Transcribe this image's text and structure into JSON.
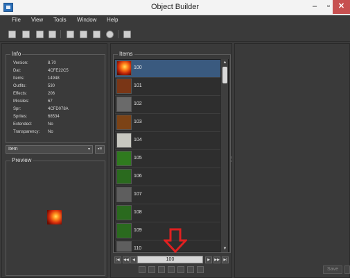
{
  "window": {
    "title": "Object Builder",
    "minimize": "–",
    "maximize": "▫",
    "close": "✕"
  },
  "menu": {
    "items": [
      "File",
      "View",
      "Tools",
      "Window",
      "Help"
    ]
  },
  "toolbar": {
    "icons": [
      "new-file-icon",
      "open-folder-icon",
      "save-icon",
      "save-as-icon",
      "compile-icon",
      "search-icon",
      "animation-editor-icon",
      "play-icon",
      "sprite-sheet-icon"
    ]
  },
  "info": {
    "legend": "Info",
    "rows": [
      {
        "label": "Version:",
        "value": "8.70"
      },
      {
        "label": "Dat:",
        "value": "4CFE22C5"
      },
      {
        "label": "Items:",
        "value": "14948"
      },
      {
        "label": "Outfits:",
        "value": "530"
      },
      {
        "label": "Effects:",
        "value": "206"
      },
      {
        "label": "Missiles:",
        "value": "67"
      },
      {
        "label": "Spr:",
        "value": "4CFD078A"
      },
      {
        "label": "Sprites:",
        "value": "68534"
      },
      {
        "label": "Extended:",
        "value": "No"
      },
      {
        "label": "Transparency:",
        "value": "No"
      }
    ]
  },
  "category": {
    "selected": "Item",
    "arrow": "▾",
    "button": "▪≡"
  },
  "preview": {
    "legend": "Preview"
  },
  "items_panel": {
    "legend": "Items",
    "rows": [
      {
        "label": "100",
        "selected": true,
        "thumb": "#d84a12"
      },
      {
        "label": "101",
        "selected": false,
        "thumb": "#7a3616"
      },
      {
        "label": "102",
        "selected": false,
        "thumb": "#6a6a6a"
      },
      {
        "label": "103",
        "selected": false,
        "thumb": "#7c4316"
      },
      {
        "label": "104",
        "selected": false,
        "thumb": "#c8c8c0"
      },
      {
        "label": "105",
        "selected": false,
        "thumb": "#2f7a1e"
      },
      {
        "label": "106",
        "selected": false,
        "thumb": "#2a6a1e"
      },
      {
        "label": "107",
        "selected": false,
        "thumb": "#5e5e5e"
      },
      {
        "label": "108",
        "selected": false,
        "thumb": "#2a6a1e"
      },
      {
        "label": "109",
        "selected": false,
        "thumb": "#2a6a1e"
      },
      {
        "label": "110",
        "selected": false,
        "thumb": "#5e5e5e"
      }
    ],
    "scroll_up": "▲",
    "scroll_down": "▼"
  },
  "pager": {
    "first": "|◀",
    "prev_fast": "◀◀",
    "prev": "◀",
    "value": "100",
    "next": "▶",
    "next_fast": "▶▶",
    "last": "▶|"
  },
  "actions": {
    "icons": [
      "replace-icon",
      "import-icon",
      "export-icon",
      "edit-icon",
      "duplicate-icon",
      "new-icon",
      "delete-icon"
    ]
  },
  "editor": {
    "save_label": "Save"
  },
  "colors": {
    "background": "#3a3a3a",
    "selection": "#3a5a7f",
    "annotation_arrow": "#e02020"
  }
}
